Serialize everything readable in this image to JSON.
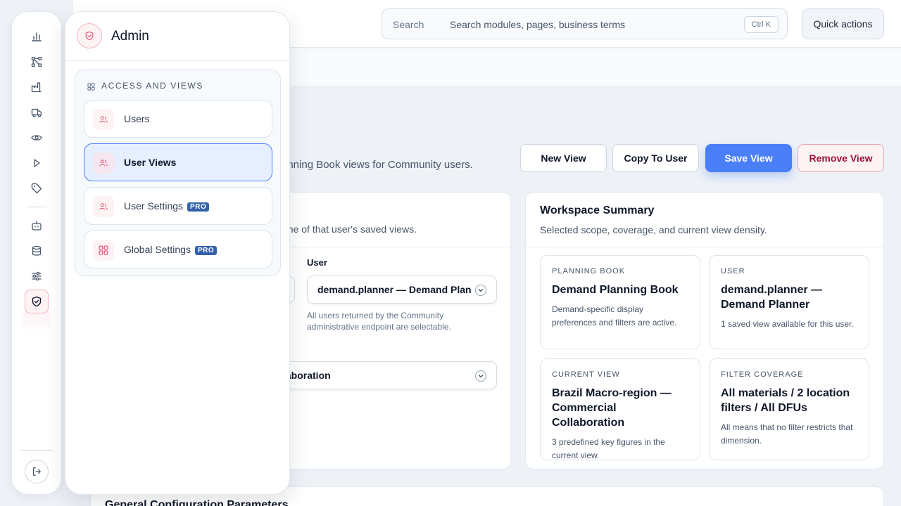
{
  "header": {
    "search_label": "Search",
    "search_placeholder": "Search modules, pages, business terms",
    "search_shortcut": "Ctrl K",
    "quick_actions_label": "Quick actions"
  },
  "page": {
    "subtitle": "anning Book views for Community users.",
    "actions": {
      "new_view": "New View",
      "copy_to_user": "Copy To User",
      "save_view": "Save View",
      "remove_view": "Remove View"
    }
  },
  "selection_card": {
    "description": "one of that user's saved views.",
    "user_label": "User",
    "user_value": "demand.planner — Demand Planner",
    "user_help": "All users returned by the Community administrative endpoint are selectable.",
    "view_value": "laboration"
  },
  "summary_card": {
    "title": "Workspace Summary",
    "description": "Selected scope, coverage, and current view density.",
    "tiles": [
      {
        "kicker": "PLANNING BOOK",
        "value": "Demand Planning Book",
        "desc": "Demand-specific display preferences and filters are active."
      },
      {
        "kicker": "USER",
        "value": "demand.planner — Demand Planner",
        "desc": "1 saved view available for this user."
      },
      {
        "kicker": "CURRENT VIEW",
        "value": "Brazil Macro-region — Commercial Collaboration",
        "desc": "3 predefined key figures in the current view."
      },
      {
        "kicker": "FILTER COVERAGE",
        "value": "All materials / 2 location filters / All DFUs",
        "desc": "All means that no filter restricts that dimension."
      }
    ]
  },
  "bottom_card": {
    "title": "General Configuration Parameters"
  },
  "rail": {
    "icons": [
      "bar-chart-icon",
      "network-icon",
      "factory-icon",
      "truck-icon",
      "eye-icon",
      "play-icon",
      "tag-icon",
      "bot-icon",
      "database-icon",
      "sliders-icon",
      "shield-icon"
    ],
    "logout_icon": "logout-icon"
  },
  "flyout": {
    "title": "Admin",
    "group_label": "ACCESS AND VIEWS",
    "items": [
      {
        "label": "Users",
        "badge": "",
        "active": false
      },
      {
        "label": "User Views",
        "badge": "",
        "active": true
      },
      {
        "label": "User Settings",
        "badge": "PRO",
        "active": false
      },
      {
        "label": "Global Settings",
        "badge": "PRO",
        "active": false
      }
    ]
  },
  "colors": {
    "accent": "#4a7ff7",
    "danger": "#9f1239",
    "admin_pink": "#e25a7a",
    "pro_badge": "#3461a8"
  }
}
